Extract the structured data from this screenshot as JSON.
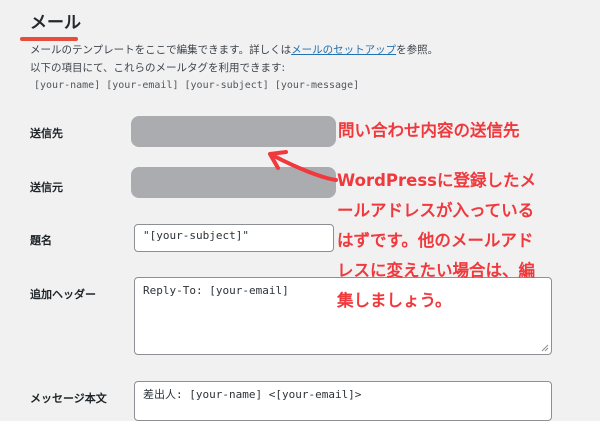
{
  "section": {
    "title": "メール",
    "description_line1_prefix": "メールのテンプレートをここで編集できます。詳しくは",
    "description_line1_link": "メールのセットアップ",
    "description_line1_suffix": "を参照。",
    "description_line2": "以下の項目にて、これらのメールタグを利用できます:",
    "mail_tags": "[your-name] [your-email] [your-subject] [your-message]"
  },
  "form": {
    "to_label": "送信先",
    "from_label": "送信元",
    "subject_label": "題名",
    "subject_value": "\"[your-subject]\"",
    "headers_label": "追加ヘッダー",
    "headers_value": "Reply-To: [your-email]",
    "body_label": "メッセージ本文",
    "body_value": "差出人: [your-name] <[your-email]>"
  },
  "annotations": {
    "callout_top": "問い合わせ内容の送信先",
    "callout_lines": [
      "WordPressに登録したメ",
      "ールアドレスが入っている",
      "はずです。他のメールアド",
      "レスに変えたい場合は、編",
      "集しましょう。"
    ],
    "color": "#f0383d"
  }
}
